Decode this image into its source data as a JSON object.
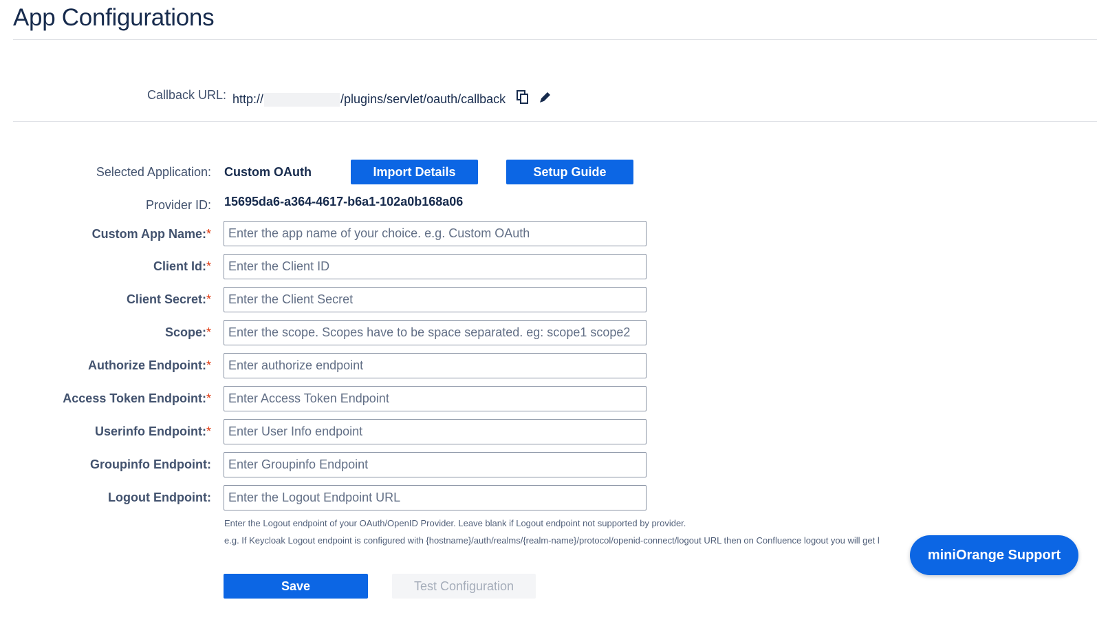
{
  "page": {
    "title": "App Configurations"
  },
  "callback": {
    "label": "Callback URL:",
    "url_prefix": "http://",
    "url_suffix": "/plugins/servlet/oauth/callback",
    "icons": [
      "copy-icon",
      "edit-pencil-icon"
    ]
  },
  "app": {
    "selected_label": "Selected Application:",
    "selected_value": "Custom OAuth",
    "import_label": "Import Details",
    "guide_label": "Setup Guide",
    "provider_label": "Provider ID:",
    "provider_value": "15695da6-a364-4617-b6a1-102a0b168a06"
  },
  "fields": [
    {
      "label": "Custom App Name:",
      "required": "*",
      "placeholder": "Enter the app name of your choice. e.g. Custom OAuth",
      "value": ""
    },
    {
      "label": "Client Id:",
      "required": "*",
      "placeholder": "Enter the Client ID",
      "value": ""
    },
    {
      "label": "Client Secret:",
      "required": "*",
      "placeholder": "Enter the Client Secret",
      "value": ""
    },
    {
      "label": "Scope:",
      "required": "*",
      "placeholder": "Enter the scope. Scopes have to be space separated. eg: scope1 scope2",
      "value": ""
    },
    {
      "label": "Authorize Endpoint:",
      "required": "*",
      "placeholder": "Enter authorize endpoint",
      "value": ""
    },
    {
      "label": "Access Token Endpoint:",
      "required": "*",
      "placeholder": "Enter Access Token Endpoint",
      "value": ""
    },
    {
      "label": "Userinfo Endpoint:",
      "required": "*",
      "placeholder": "Enter User Info endpoint",
      "value": ""
    },
    {
      "label": "Groupinfo Endpoint:",
      "required": "",
      "placeholder": "Enter Groupinfo Endpoint",
      "value": ""
    },
    {
      "label": "Logout Endpoint:",
      "required": "",
      "placeholder": "Enter the Logout Endpoint URL",
      "value": ""
    }
  ],
  "help": {
    "line1": "Enter the Logout endpoint of your OAuth/OpenID Provider. Leave blank if Logout endpoint not supported by provider.",
    "line2": "e.g. If Keycloak Logout endpoint is configured with {hostname}/auth/realms/{realm-name}/protocol/openid-connect/logout URL then on Confluence logout you will get l"
  },
  "actions": {
    "save_label": "Save",
    "test_label": "Test Configuration"
  },
  "support": {
    "label": "miniOrange Support"
  },
  "colors": {
    "primary": "#0c66e4",
    "required": "#de350b",
    "text": "#172b4d"
  }
}
